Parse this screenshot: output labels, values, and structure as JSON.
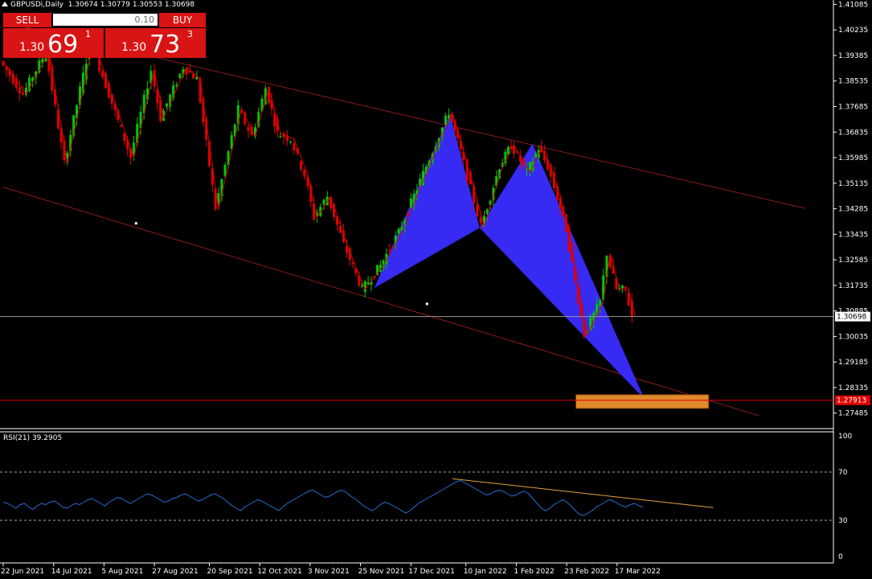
{
  "header": {
    "symbol": "GBPUSDi,Daily",
    "ohlc": "1.30674 1.30779 1.30553 1.30698"
  },
  "trade_panel": {
    "sell_label": "SELL",
    "buy_label": "BUY",
    "lot": "0.10",
    "sell_prefix": "1.30",
    "sell_big": "69",
    "sell_sup": "1",
    "buy_prefix": "1.30",
    "buy_big": "73",
    "buy_sup": "3"
  },
  "colors": {
    "bull": "#00c800",
    "bear": "#e00000",
    "pattern": "#3a2cff",
    "rsi": "#2a6fd8",
    "zone": "#e08a2c",
    "channel": "#8b1a1a"
  },
  "chart_data": [
    {
      "type": "candlestick",
      "y_ticks": [
        "1.41085",
        "1.40235",
        "1.39385",
        "1.38535",
        "1.37685",
        "1.36835",
        "1.35985",
        "1.35135",
        "1.34285",
        "1.33435",
        "1.32585",
        "1.31735",
        "1.30885",
        "1.30035",
        "1.29185",
        "1.28335",
        "1.27485"
      ],
      "ylim": [
        1.2705,
        1.4115
      ],
      "x_ticks": [
        "22 Jun 2021",
        "14 Jul 2021",
        "5 Aug 2021",
        "27 Aug 2021",
        "20 Sep 2021",
        "12 Oct 2021",
        "3 Nov 2021",
        "25 Nov 2021",
        "17 Dec 2021",
        "10 Jan 2022",
        "1 Feb 2022",
        "23 Feb 2022",
        "17 Mar 2022"
      ],
      "x_tick_days": [
        0,
        22,
        44,
        66,
        90,
        112,
        134,
        156,
        178,
        202,
        224,
        246,
        268
      ],
      "last_price": "1.30698",
      "target_price": "1.27913",
      "swings": [
        [
          0,
          1.392
        ],
        [
          10,
          1.381
        ],
        [
          20,
          1.395
        ],
        [
          28,
          1.358
        ],
        [
          39,
          1.397
        ],
        [
          42,
          1.393
        ],
        [
          57,
          1.36
        ],
        [
          66,
          1.389
        ],
        [
          70,
          1.373
        ],
        [
          80,
          1.39
        ],
        [
          86,
          1.386
        ],
        [
          94,
          1.343
        ],
        [
          104,
          1.376
        ],
        [
          110,
          1.367
        ],
        [
          116,
          1.383
        ],
        [
          121,
          1.368
        ],
        [
          127,
          1.366
        ],
        [
          133,
          1.354
        ],
        [
          137,
          1.34
        ],
        [
          143,
          1.347
        ],
        [
          150,
          1.331
        ],
        [
          158,
          1.316
        ],
        [
          166,
          1.324
        ],
        [
          174,
          1.335
        ],
        [
          186,
          1.357
        ],
        [
          196,
          1.375
        ],
        [
          201,
          1.362
        ],
        [
          210,
          1.337
        ],
        [
          218,
          1.357
        ],
        [
          223,
          1.364
        ],
        [
          230,
          1.355
        ],
        [
          235,
          1.363
        ],
        [
          239,
          1.357
        ],
        [
          242,
          1.35
        ],
        [
          247,
          1.336
        ],
        [
          255,
          1.301
        ],
        [
          262,
          1.312
        ],
        [
          265,
          1.328
        ],
        [
          269,
          1.316
        ],
        [
          273,
          1.316
        ],
        [
          276,
          1.307
        ]
      ],
      "harmonic_pattern": {
        "X": [
          162,
          1.3165
        ],
        "A": [
          195,
          1.3745
        ],
        "B": [
          208,
          1.3365
        ],
        "C": [
          231,
          1.3645
        ],
        "D": [
          280,
          1.2795
        ]
      },
      "channel": {
        "upper": [
          [
            0,
            1.405
          ],
          [
            350,
            1.343
          ]
        ],
        "lower": [
          [
            0,
            1.35
          ],
          [
            330,
            1.274
          ]
        ]
      },
      "channel_markers": [
        [
          58,
          1.338
        ],
        [
          185,
          1.3112
        ]
      ],
      "target_zone": {
        "x0": 250,
        "x1": 308,
        "y0": 1.281,
        "y1": 1.2764
      }
    },
    {
      "type": "line",
      "title": "RSI(21) 39.2905",
      "y_ticks": [
        "100",
        "70",
        "30",
        "0"
      ],
      "ylim": [
        0,
        100
      ],
      "levels": [
        70,
        30
      ],
      "values": [
        45,
        44,
        42,
        40,
        43,
        44,
        41,
        39,
        42,
        44,
        43,
        45,
        46,
        44,
        41,
        40,
        42,
        44,
        43,
        45,
        47,
        48,
        46,
        44,
        42,
        45,
        47,
        49,
        48,
        46,
        44,
        46,
        48,
        50,
        52,
        51,
        49,
        47,
        45,
        46,
        48,
        49,
        51,
        52,
        50,
        48,
        46,
        47,
        49,
        51,
        52,
        50,
        48,
        45,
        42,
        40,
        38,
        41,
        43,
        45,
        47,
        46,
        44,
        42,
        40,
        38,
        41,
        44,
        46,
        48,
        50,
        52,
        54,
        55,
        53,
        51,
        49,
        50,
        52,
        54,
        55,
        53,
        50,
        48,
        45,
        42,
        40,
        38,
        40,
        43,
        45,
        44,
        42,
        40,
        38,
        36,
        38,
        41,
        44,
        46,
        48,
        50,
        52,
        54,
        56,
        58,
        60,
        62,
        63,
        61,
        59,
        57,
        55,
        53,
        51,
        52,
        54,
        55,
        54,
        52,
        50,
        51,
        53,
        54,
        52,
        48,
        44,
        40,
        38,
        40,
        43,
        45,
        47,
        45,
        42,
        38,
        35,
        34,
        36,
        38,
        41,
        43,
        45,
        47,
        46,
        44,
        42,
        41,
        43,
        44,
        42,
        41
      ],
      "x_start": 0,
      "x_step": 1.85,
      "trendline": [
        [
          196,
          64.5
        ],
        [
          310,
          40.5
        ]
      ]
    }
  ]
}
